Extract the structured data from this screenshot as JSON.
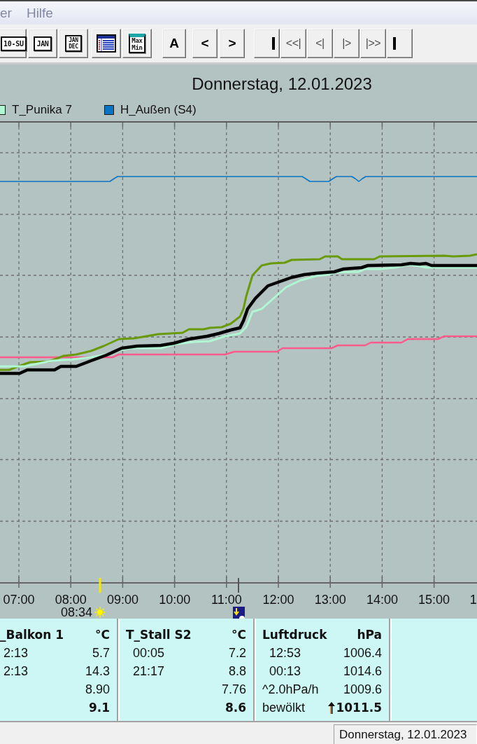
{
  "menu": {
    "items": [
      "er",
      "Hilfe"
    ]
  },
  "toolbar": {
    "groups": [
      {
        "buttons": [
          {
            "kind": "boxed",
            "label": "10-SU"
          },
          {
            "kind": "boxed",
            "label": "JAN"
          },
          {
            "kind": "stacked",
            "label": "JAN DEC"
          }
        ]
      },
      {
        "buttons": [
          {
            "kind": "table"
          },
          {
            "kind": "maxmin",
            "label": "Max Min"
          }
        ]
      },
      {
        "buttons": [
          {
            "kind": "glyph",
            "label": "A"
          }
        ]
      },
      {
        "buttons": [
          {
            "kind": "glyph",
            "label": "<"
          },
          {
            "kind": "glyph",
            "label": ">"
          }
        ]
      },
      {
        "buttons": [
          {
            "kind": "endbar"
          },
          {
            "kind": "nav",
            "label": "<<|"
          },
          {
            "kind": "nav",
            "label": "<|"
          },
          {
            "kind": "nav",
            "label": "|>"
          },
          {
            "kind": "nav",
            "label": "|>>"
          },
          {
            "kind": "startbar"
          }
        ]
      }
    ]
  },
  "chart": {
    "title": "Donnerstag, 12.01.2023",
    "legend": [
      {
        "label": "T_Punika 7",
        "color": "#b0f8d4"
      },
      {
        "label": "H_Außen (S4)",
        "color": "#0a74c4"
      }
    ],
    "x_labels": [
      "07:00",
      "08:00",
      "09:00",
      "10:00",
      "11:00",
      "12:00",
      "13:00",
      "14:00",
      "15:00",
      "1"
    ],
    "sunrise": {
      "time": "08:34"
    }
  },
  "panels": [
    {
      "title": "_Balkon 1",
      "unit": "°C",
      "rows": [
        {
          "kind": "min",
          "label": "2:13",
          "value": "5.7"
        },
        {
          "kind": "max",
          "label": "2:13",
          "value": "14.3"
        },
        {
          "kind": "avg",
          "value": "8.90"
        },
        {
          "kind": "current",
          "value": "9.1"
        }
      ]
    },
    {
      "title": "T_Stall S2",
      "unit": "°C",
      "rows": [
        {
          "kind": "min",
          "label": "00:05",
          "value": "7.2"
        },
        {
          "kind": "max",
          "label": "21:17",
          "value": "8.8"
        },
        {
          "kind": "avg",
          "value": "7.76"
        },
        {
          "kind": "current",
          "value": "8.6"
        }
      ]
    },
    {
      "title": "Luftdruck",
      "unit": "hPa",
      "rows": [
        {
          "kind": "min",
          "label": "12:53",
          "value": "1006.4"
        },
        {
          "kind": "max",
          "label": "00:13",
          "value": "1014.6"
        },
        {
          "kind": "avg",
          "label": "^2.0hPa/h",
          "value": "1009.6"
        },
        {
          "kind": "current",
          "label": "bewölkt",
          "value": "1011.5",
          "rising": true
        }
      ]
    }
  ],
  "status_bar": {
    "panes": [
      "Donnerstag, 12.01.2023"
    ]
  }
}
